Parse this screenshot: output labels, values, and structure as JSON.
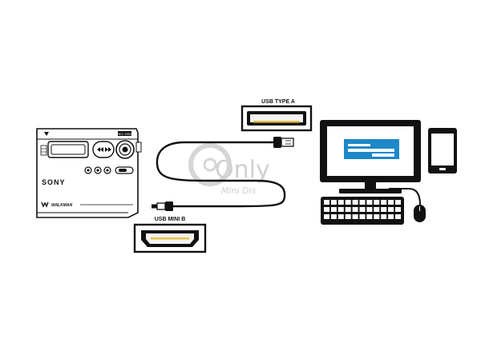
{
  "labels": {
    "usb_type_a": "USB TYPE A",
    "usb_mini_b": "USB MINI B"
  },
  "device": {
    "brand": "SONY",
    "sub_brand": "WALKMAN",
    "top_tag": "REC REM"
  },
  "watermark": {
    "line1": "Only",
    "line2": "Mini Dis"
  },
  "colors": {
    "outline": "#111111",
    "screen_accent": "#1e88c8",
    "connector_pins": "#e6c24a",
    "watermark": "#c8c8c8"
  }
}
